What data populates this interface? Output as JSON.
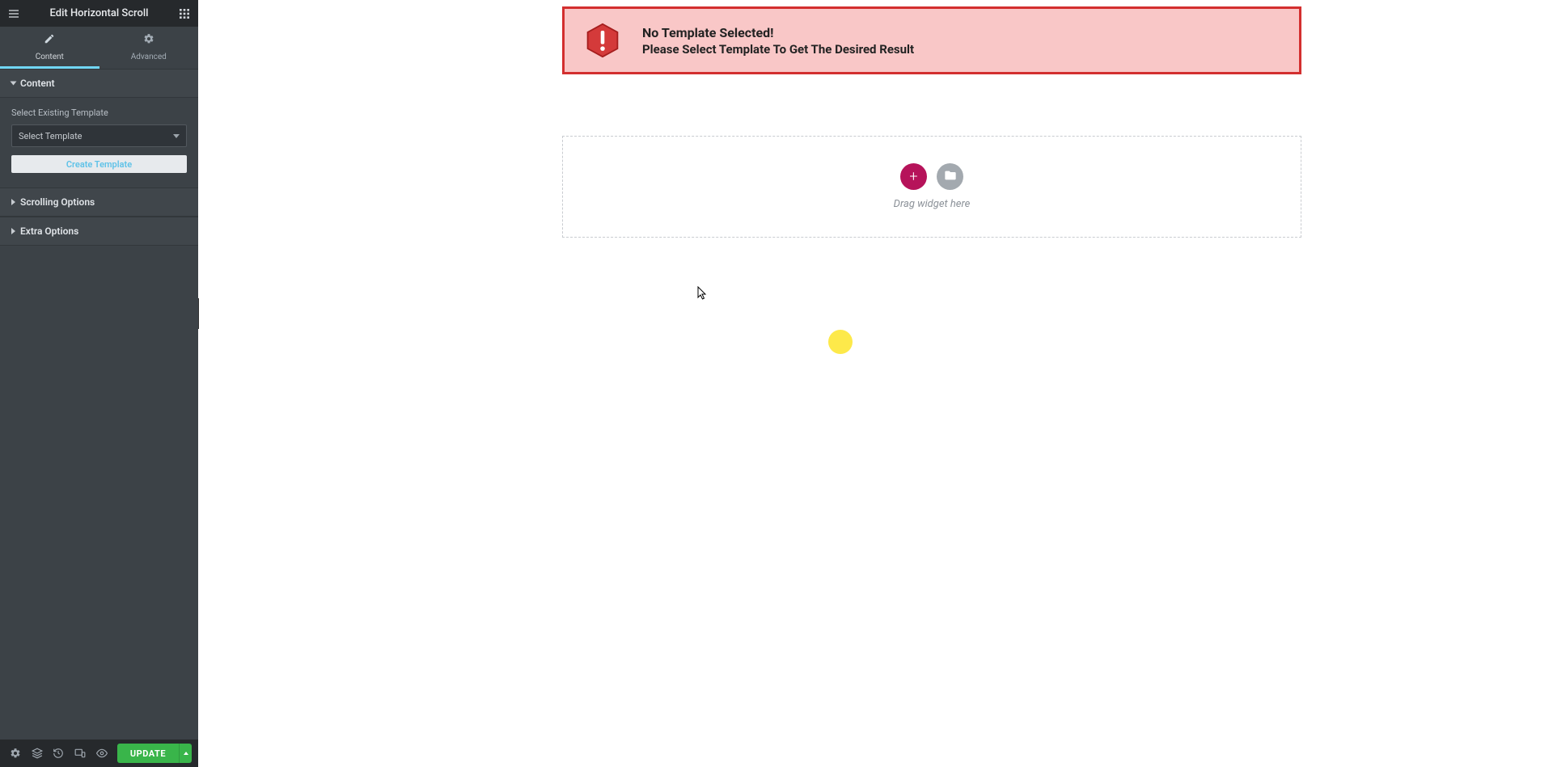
{
  "header": {
    "title": "Edit Horizontal Scroll"
  },
  "tabs": {
    "content": "Content",
    "advanced": "Advanced"
  },
  "sections": {
    "content": {
      "title": "Content"
    },
    "scrolling": {
      "title": "Scrolling Options"
    },
    "extra": {
      "title": "Extra Options"
    }
  },
  "fields": {
    "templateLabel": "Select Existing Template",
    "templateSelected": "Select Template",
    "createTemplate": "Create Template"
  },
  "footer": {
    "update": "UPDATE"
  },
  "alert": {
    "title": "No Template Selected!",
    "sub": "Please Select Template To Get The Desired Result"
  },
  "dropzone": {
    "hint": "Drag widget here"
  }
}
